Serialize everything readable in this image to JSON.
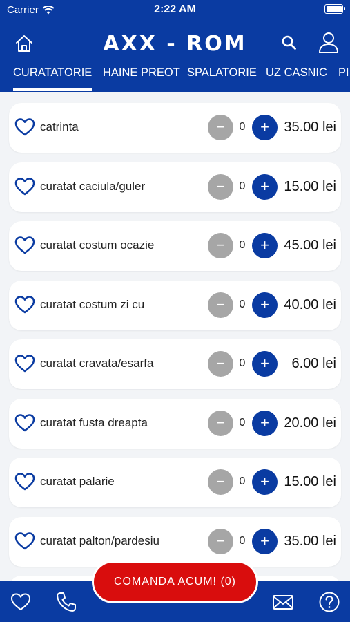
{
  "status_bar": {
    "carrier": "Carrier",
    "time": "2:22 AM"
  },
  "header": {
    "logo": "AXX - ROM"
  },
  "tabs": [
    {
      "label": "CURATATORIE",
      "active": true
    },
    {
      "label": "HAINE PREOT",
      "active": false
    },
    {
      "label": "SPALATORIE",
      "active": false
    },
    {
      "label": "UZ CASNIC",
      "active": false
    },
    {
      "label": "PI",
      "active": false
    }
  ],
  "items": [
    {
      "name": "catrinta",
      "qty": "0",
      "price": "35.00 lei"
    },
    {
      "name": "curatat caciula/guler",
      "qty": "0",
      "price": "15.00 lei"
    },
    {
      "name": "curatat costum ocazie",
      "qty": "0",
      "price": "45.00 lei"
    },
    {
      "name": "curatat costum zi cu",
      "qty": "0",
      "price": "40.00 lei"
    },
    {
      "name": "curatat cravata/esarfa",
      "qty": "0",
      "price": "6.00 lei"
    },
    {
      "name": "curatat fusta dreapta",
      "qty": "0",
      "price": "20.00 lei"
    },
    {
      "name": "curatat palarie",
      "qty": "0",
      "price": "15.00 lei"
    },
    {
      "name": "curatat palton/pardesiu",
      "qty": "0",
      "price": "35.00 lei"
    }
  ],
  "order_button": {
    "label": "COMANDA ACUM! (0)"
  },
  "colors": {
    "primary": "#0a3ba2",
    "accent": "#d90d0d",
    "minus": "#a6a6a6"
  }
}
